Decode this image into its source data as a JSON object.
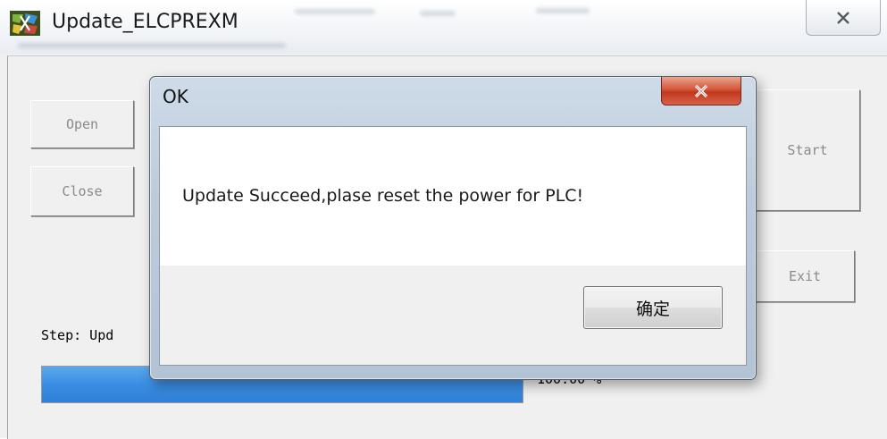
{
  "window": {
    "title": "Update_ELCPREXM",
    "close_icon": "close-x-icon",
    "app_icon": "app-logo-icon"
  },
  "buttons": {
    "open": "Open",
    "close": "Close",
    "start": "Start",
    "exit": "Exit"
  },
  "status": {
    "step_text": "Step: Upd",
    "progress_fraction": 1.0,
    "progress_text": "100.00 %"
  },
  "dialog": {
    "title": "OK",
    "message": "Update Succeed,plase reset the power for PLC!",
    "confirm_label": "确定",
    "close_icon": "close-x-icon"
  },
  "colors": {
    "progress_fill": "#3a8ee3",
    "dialog_close_red": "#c0391f"
  }
}
